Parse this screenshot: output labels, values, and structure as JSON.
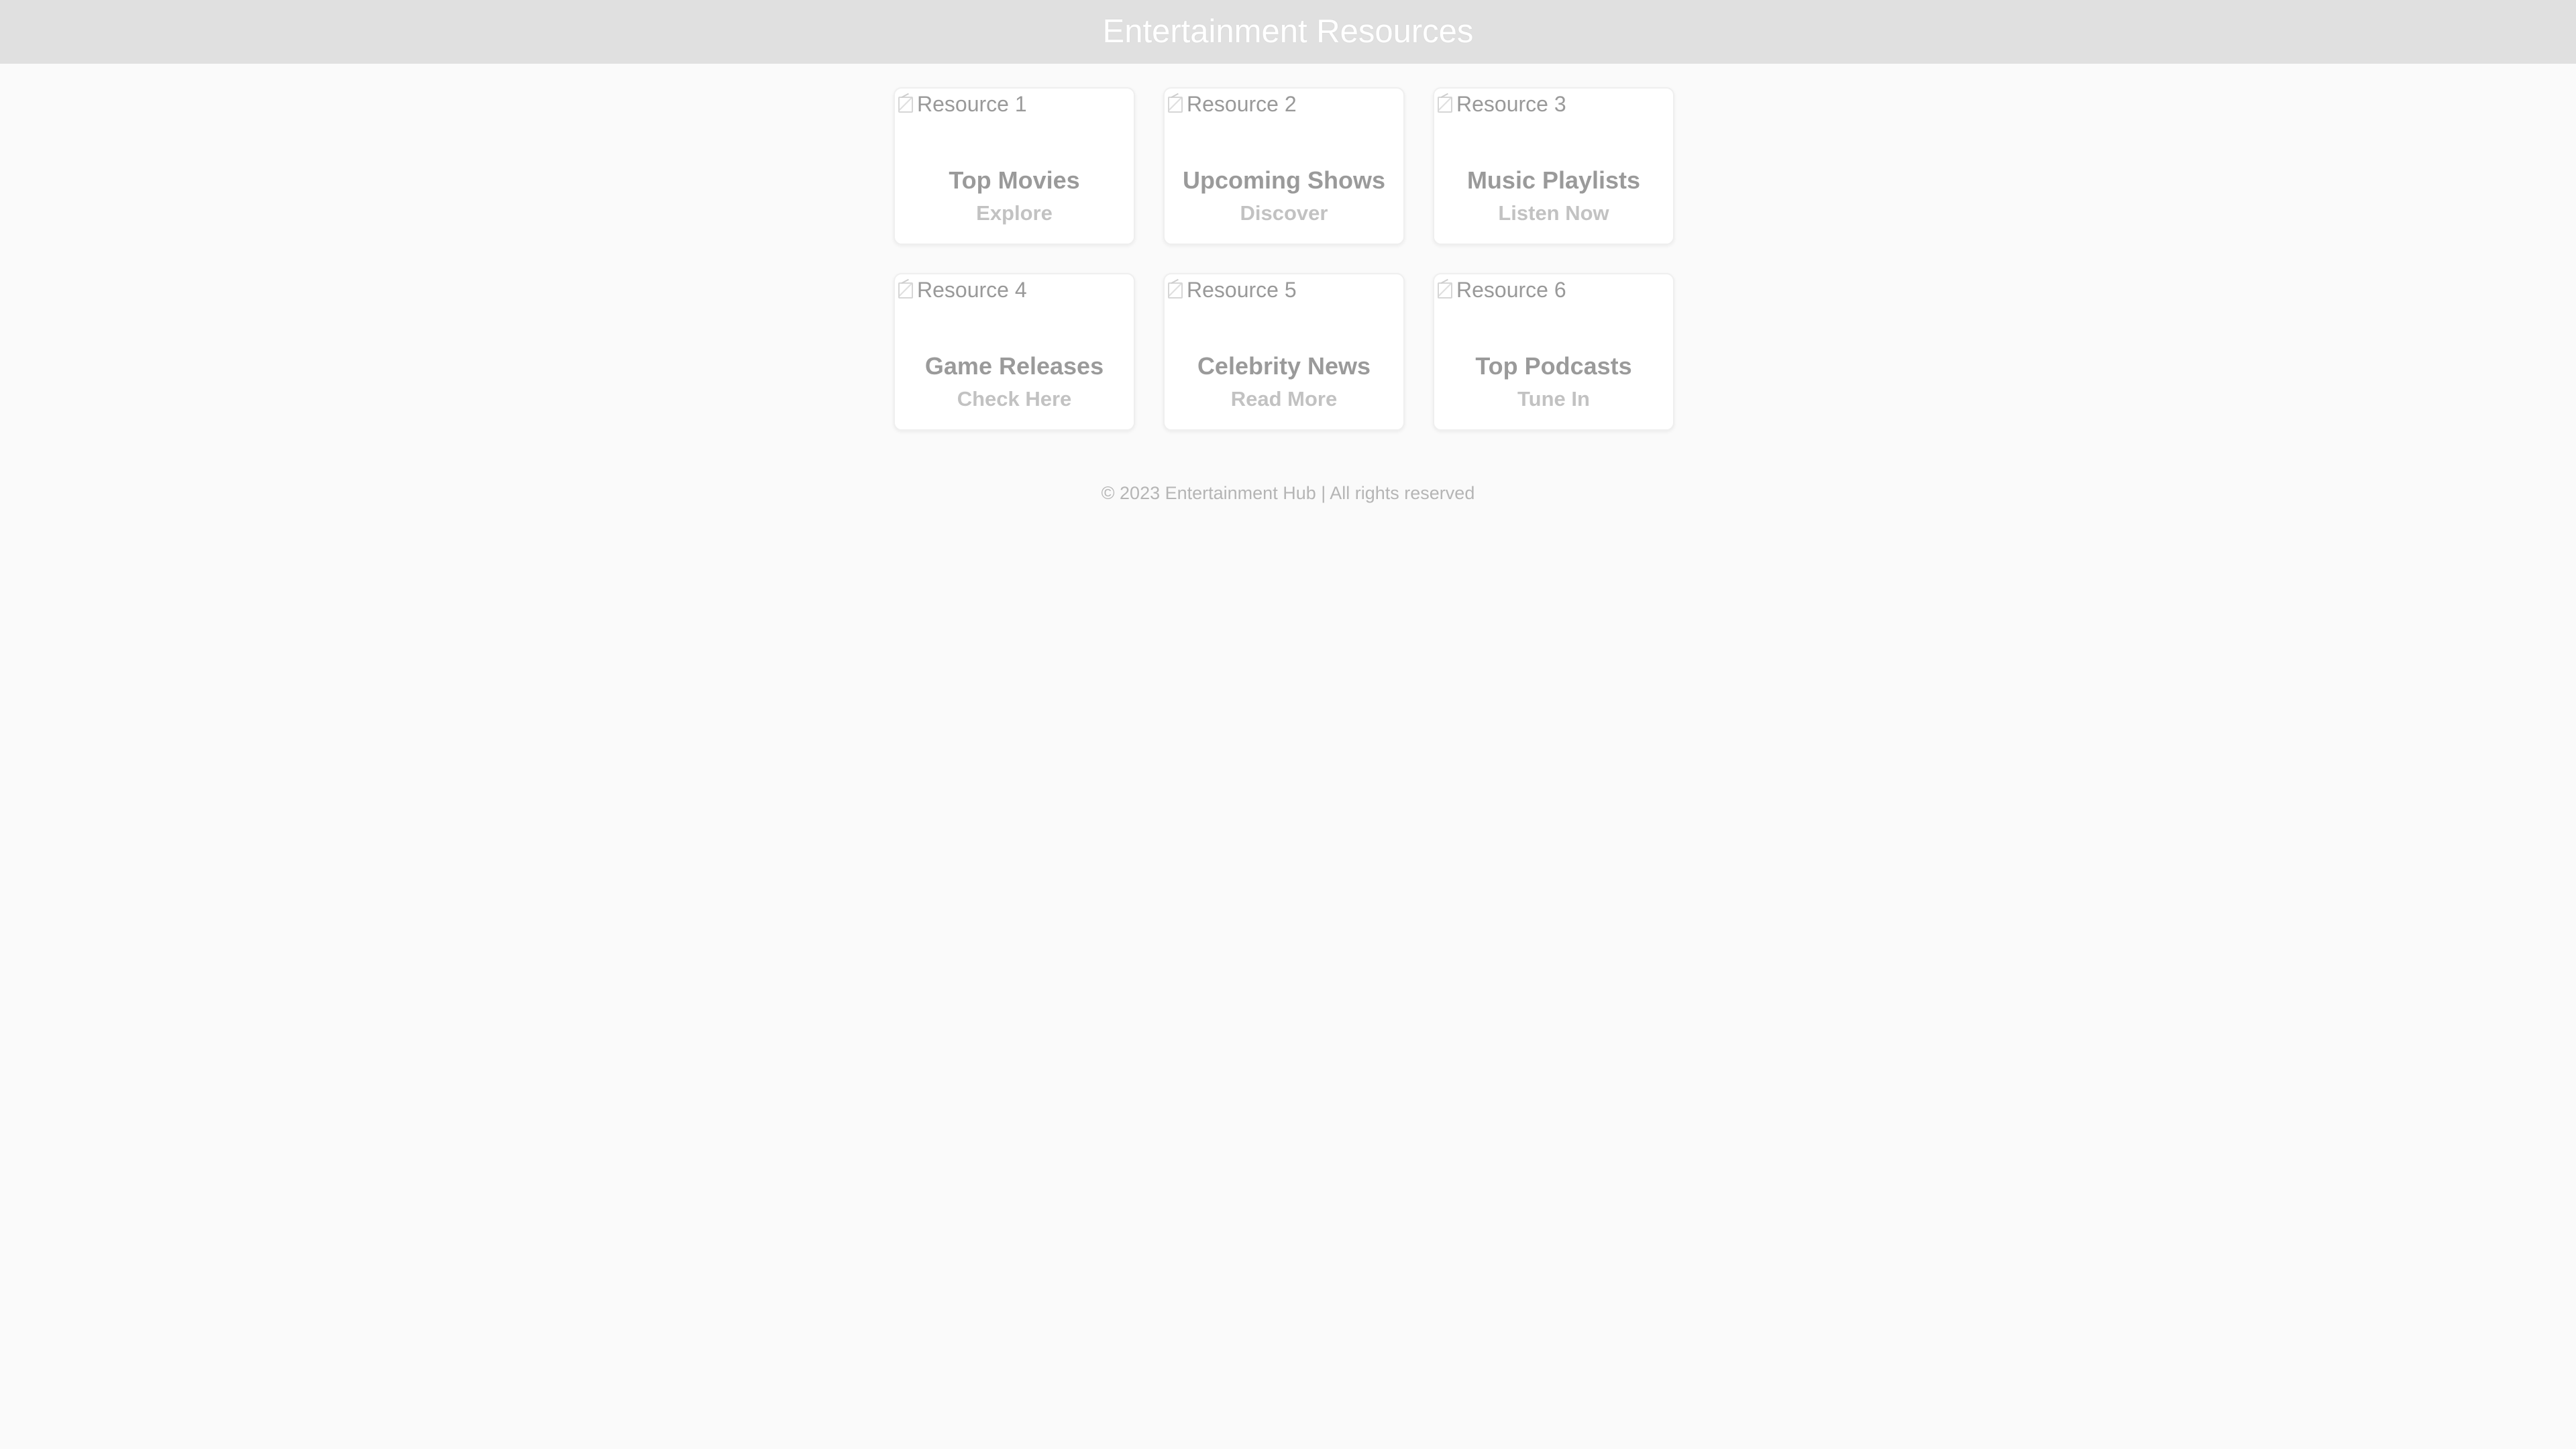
{
  "header": {
    "title": "Entertainment Resources"
  },
  "resources": [
    {
      "image_alt": "Resource 1",
      "title": "Top Movies",
      "action_label": "Explore"
    },
    {
      "image_alt": "Resource 2",
      "title": "Upcoming Shows",
      "action_label": "Discover"
    },
    {
      "image_alt": "Resource 3",
      "title": "Music Playlists",
      "action_label": "Listen Now"
    },
    {
      "image_alt": "Resource 4",
      "title": "Game Releases",
      "action_label": "Check Here"
    },
    {
      "image_alt": "Resource 5",
      "title": "Celebrity News",
      "action_label": "Read More"
    },
    {
      "image_alt": "Resource 6",
      "title": "Top Podcasts",
      "action_label": "Tune In"
    }
  ],
  "footer": {
    "text": "© 2023 Entertainment Hub | All rights reserved"
  },
  "colors": {
    "page_background": "#fafafa",
    "header_background": "#e0e0e0",
    "header_text": "#ffffff",
    "card_background": "#ffffff",
    "card_border": "#efefef",
    "card_title": "#9a9a9a",
    "card_action": "#c2c2c2",
    "footer_text": "#b5b5b5"
  },
  "icons": {
    "image_placeholder": "broken-image-icon"
  }
}
